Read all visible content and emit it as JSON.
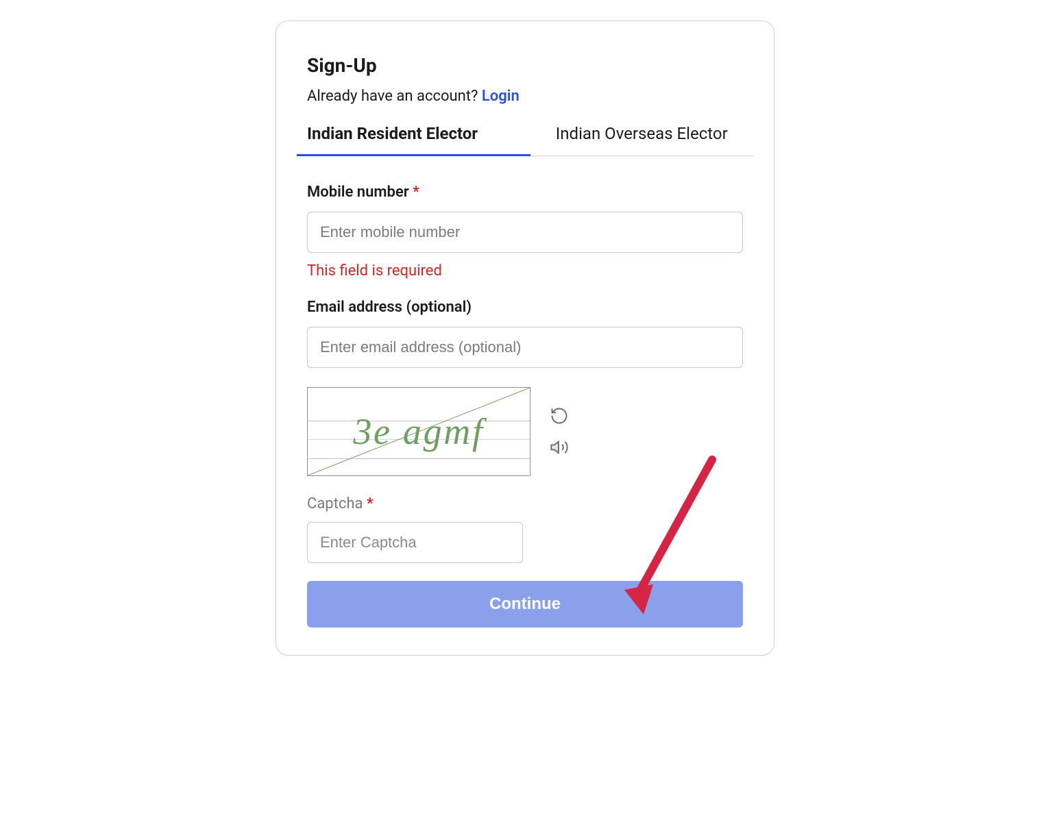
{
  "header": {
    "title": "Sign-Up",
    "already_text": "Already have an account? ",
    "login_label": "Login"
  },
  "tabs": {
    "resident": "Indian Resident Elector",
    "overseas": "Indian Overseas Elector"
  },
  "form": {
    "mobile": {
      "label": "Mobile number ",
      "placeholder": "Enter mobile number",
      "error": "This field is required"
    },
    "email": {
      "label": "Email address (optional)",
      "placeholder": "Enter email address (optional)"
    },
    "captcha": {
      "image_text": "3e agmf",
      "label": "Captcha ",
      "placeholder": "Enter Captcha"
    },
    "continue_label": "Continue"
  },
  "colors": {
    "primary": "#2451e0",
    "error": "#d62424",
    "button": "#8aa0ea",
    "arrow": "#d62444"
  }
}
